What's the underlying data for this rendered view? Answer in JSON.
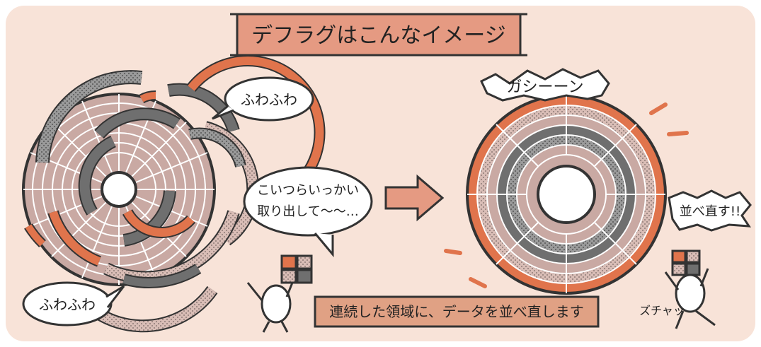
{
  "title": "デフラグはこんなイメージ",
  "bubbles": {
    "fuwa_top": "ふわふわ",
    "fuwa_bottom": "ふわふわ",
    "grab_line1": "こいつらいっかい",
    "grab_line2": "取り出して〜〜…",
    "sound": "ガシーーン",
    "rearrange": "並べ直す!!",
    "swish": "ズチャッ"
  },
  "caption": "連続した領域に、データを並べ直します",
  "colors": {
    "background": "#f8e3d8",
    "accent_orange": "#e0744c",
    "dark_gray": "#6f6f6f",
    "light_pink": "#c9a9a3",
    "title_box": "#e59a82",
    "caption_box": "#e0a184"
  },
  "icons": [
    "right-arrow-icon",
    "data-block-icon"
  ]
}
